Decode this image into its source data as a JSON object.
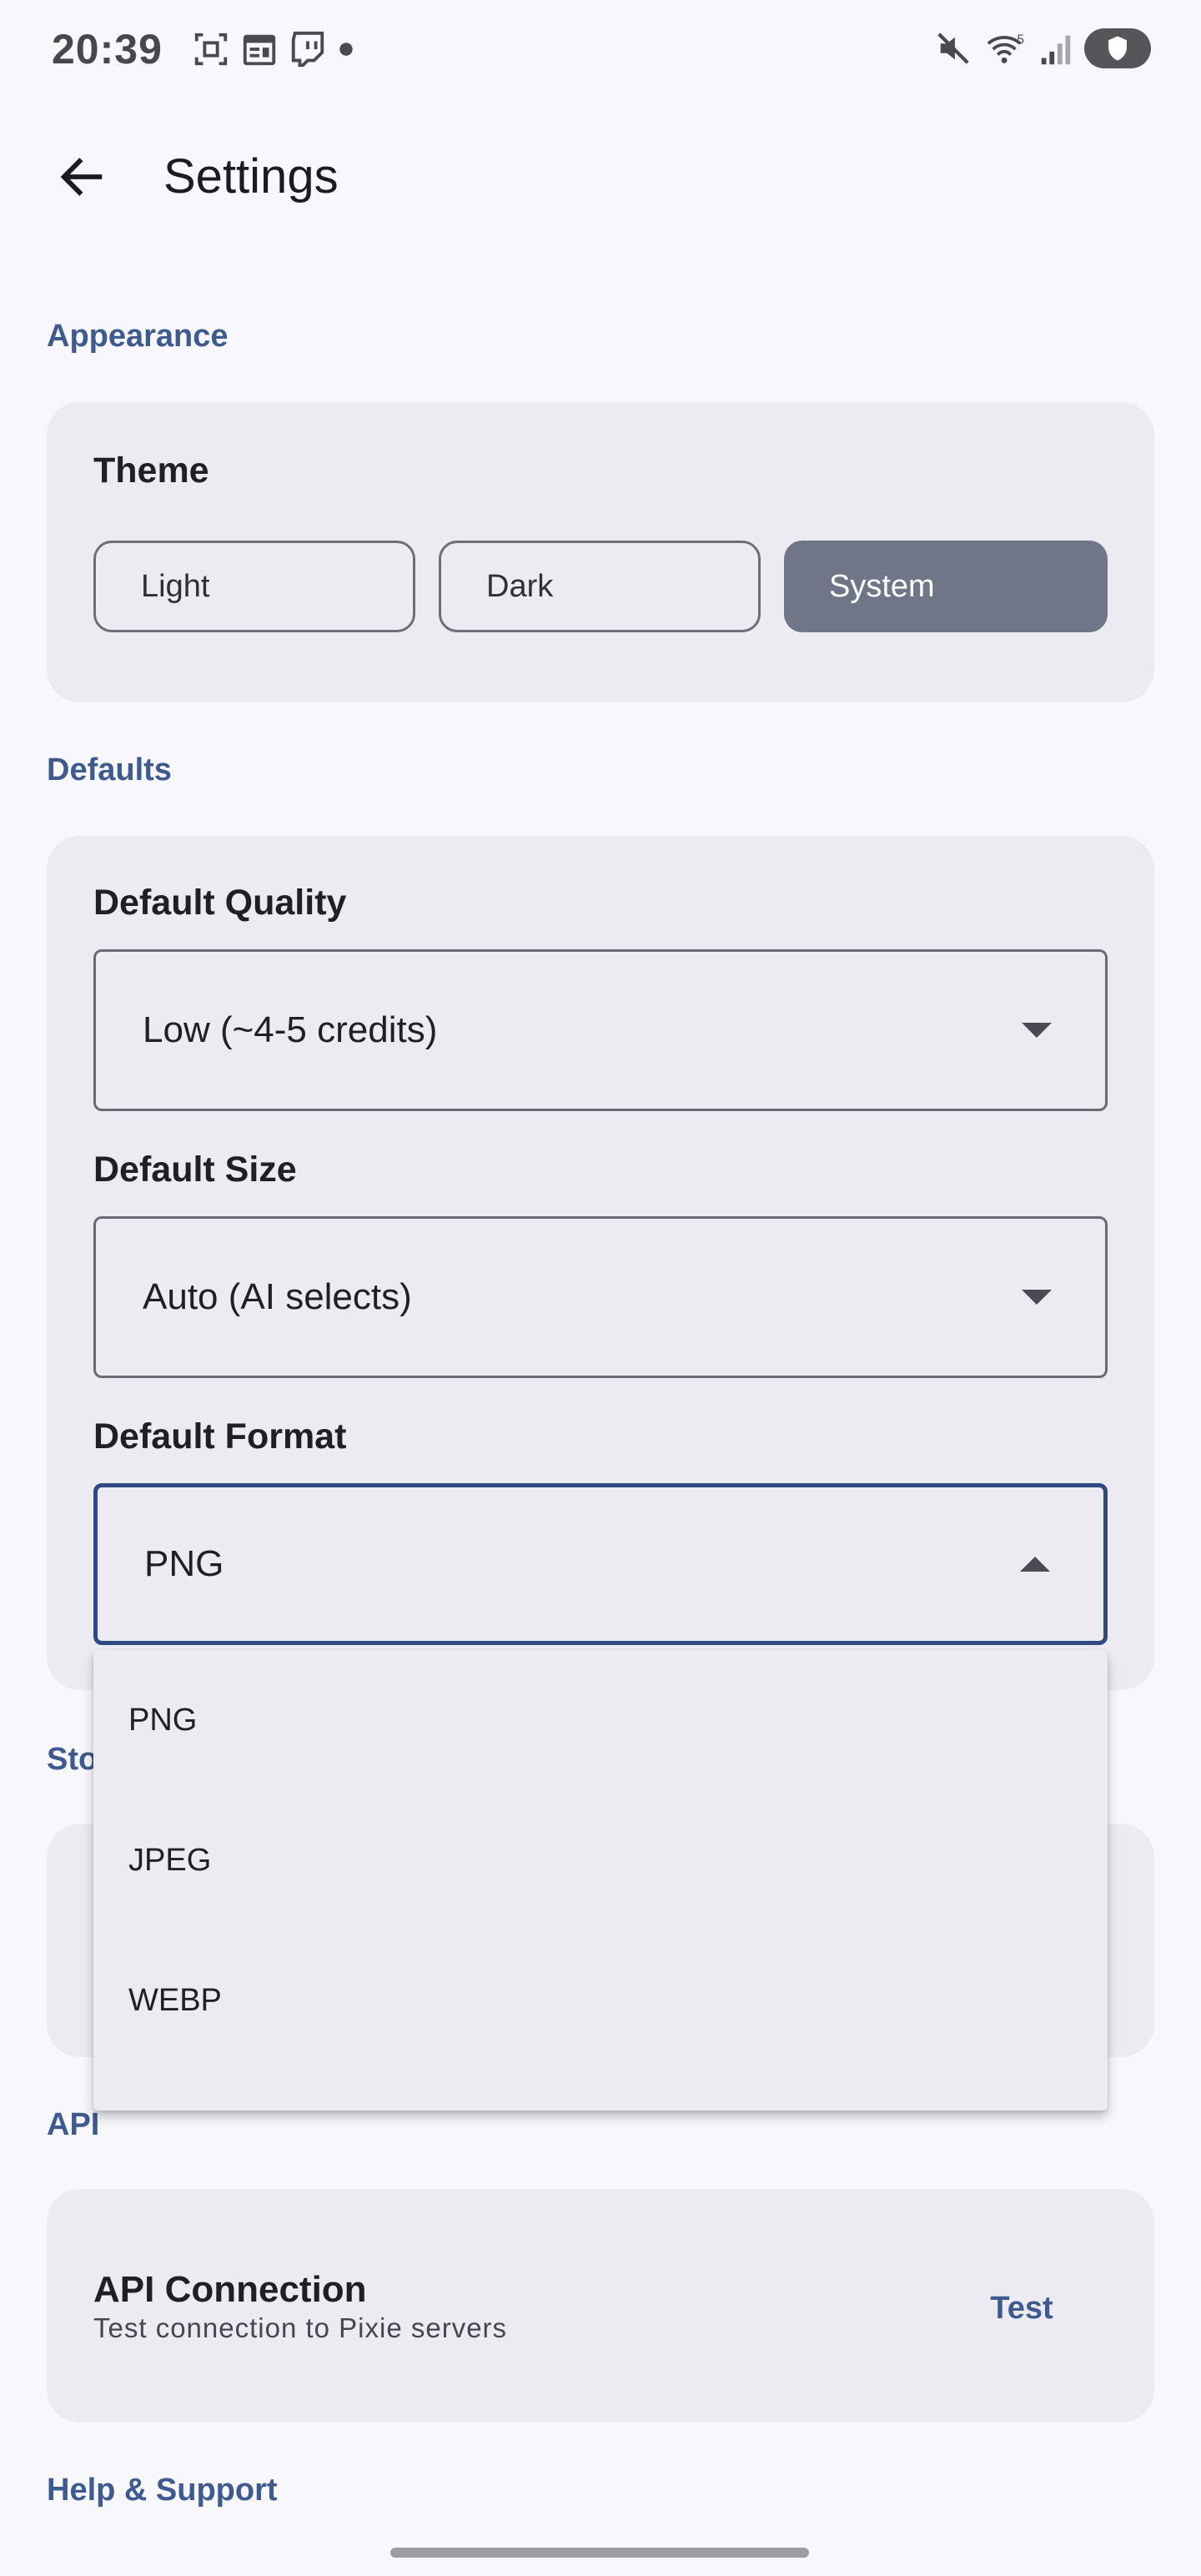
{
  "status_bar": {
    "time": "20:39",
    "left_icons": [
      "screenshot-icon",
      "calendar-icon",
      "twitch-icon",
      "dot-icon"
    ],
    "right_icons": [
      "muted-icon",
      "wifi-icon",
      "signal-icon",
      "battery-icon"
    ]
  },
  "app_bar": {
    "back_icon": "arrow-left-icon",
    "title": "Settings"
  },
  "sections": {
    "appearance": "Appearance",
    "defaults": "Defaults",
    "storage_partial": "Sto",
    "api": "API",
    "help": "Help & Support"
  },
  "theme": {
    "label": "Theme",
    "options": [
      "Light",
      "Dark",
      "System"
    ],
    "selected": "System"
  },
  "defaults": {
    "quality_label": "Default Quality",
    "quality_value": "Low (~4-5 credits)",
    "size_label": "Default Size",
    "size_value": "Auto (AI selects)",
    "format_label": "Default Format",
    "format_value": "PNG"
  },
  "format_menu": {
    "options": [
      "PNG",
      "JPEG",
      "WEBP"
    ]
  },
  "api_card": {
    "title": "API Connection",
    "subtitle": "Test connection to Pixie servers",
    "button": "Test"
  },
  "colors": {
    "accent": "#3e5a8e",
    "card_bg": "#ecebf2",
    "page_bg": "#f8f7fc",
    "selected_segment": "#6e7688"
  }
}
